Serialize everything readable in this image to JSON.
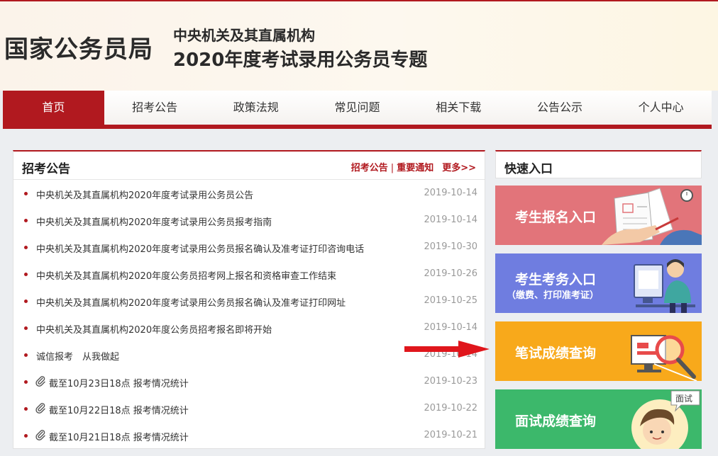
{
  "header": {
    "brand": "国家公务员局",
    "subtitle_line1": "中央机关及其直属机构",
    "subtitle_line2": "2020年度考试录用公务员专题"
  },
  "nav": {
    "items": [
      "首页",
      "招考公告",
      "政策法规",
      "常见问题",
      "相关下载",
      "公告公示",
      "个人中心"
    ],
    "active_index": 0
  },
  "announcements": {
    "title": "招考公告",
    "link1": "招考公告",
    "separator": "|",
    "link2": "重要通知",
    "more": "更多>>",
    "items": [
      {
        "text": "中央机关及其直属机构2020年度考试录用公务员公告",
        "date": "2019-10-14",
        "icon": "bullet"
      },
      {
        "text": "中央机关及其直属机构2020年度考试录用公务员报考指南",
        "date": "2019-10-14",
        "icon": "bullet"
      },
      {
        "text": "中央机关及其直属机构2020年度考试录用公务员报名确认及准考证打印咨询电话",
        "date": "2019-10-30",
        "icon": "bullet"
      },
      {
        "text": "中央机关及其直属机构2020年度公务员招考网上报名和资格审查工作结束",
        "date": "2019-10-26",
        "icon": "bullet"
      },
      {
        "text": "中央机关及其直属机构2020年度考试录用公务员报名确认及准考证打印网址",
        "date": "2019-10-25",
        "icon": "bullet"
      },
      {
        "text": "中央机关及其直属机构2020年度公务员招考报名即将开始",
        "date": "2019-10-14",
        "icon": "bullet"
      },
      {
        "text": "诚信报考　从我做起",
        "date": "2019-10-14",
        "icon": "bullet"
      },
      {
        "text": "截至10月23日18点 报考情况统计",
        "date": "2019-10-23",
        "icon": "paperclip"
      },
      {
        "text": "截至10月22日18点 报考情况统计",
        "date": "2019-10-22",
        "icon": "paperclip"
      },
      {
        "text": "截至10月21日18点 报考情况统计",
        "date": "2019-10-21",
        "icon": "paperclip"
      }
    ]
  },
  "quick_entry": {
    "title": "快速入口",
    "cards": [
      {
        "label": "考生报名入口",
        "note": "",
        "color": "#e2747a"
      },
      {
        "label": "考生考务入口",
        "note": "（缴费、打印准考证）",
        "color": "#6f7de0"
      },
      {
        "label": "笔试成绩查询",
        "note": "",
        "color": "#f8a91b"
      },
      {
        "label": "面试成绩查询",
        "note": "",
        "color": "#3cb86b"
      }
    ],
    "interview_badge": "面试"
  },
  "colors": {
    "brand_red": "#b1191f",
    "arrow_red": "#e0161c"
  }
}
